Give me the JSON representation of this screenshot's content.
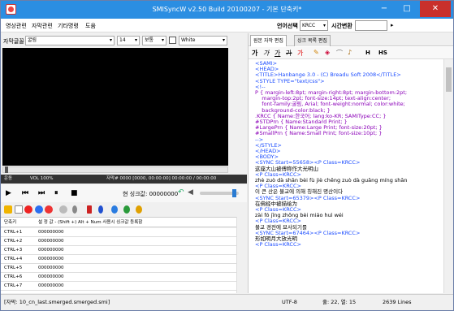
{
  "window": {
    "title": "SMISyncW v2.50 Build 20100207 - 기본 단축키*",
    "min": "−",
    "max": "□",
    "close": "✕"
  },
  "menu": {
    "items": [
      "영상관련",
      "자막관련",
      "기타명령",
      "도움"
    ],
    "lang_label": "언어선택",
    "lang_value": "KRCC",
    "time_label": "시간변환",
    "time_arrow": "▸"
  },
  "toolbar": {
    "font_label": "자막글꼴",
    "font_name": "굴림",
    "font_size": "14",
    "font_style": "보통",
    "color_name": "White"
  },
  "video_status": {
    "volume": "VOL 100%",
    "subtitle_info": "자막# 0000 [0000, 00:00:00] 00:00:00 / 00:00:00",
    "left_label": "운동"
  },
  "player": {
    "sync_label": "현 싱크값: 00000000",
    "buttons": [
      "▶",
      "⏮",
      "⏭",
      "⏸",
      "■"
    ]
  },
  "list": {
    "headers": [
      "단축키",
      "설 정 값 - (Shift +) Alt + Num 사용시 싱크값 등록함"
    ],
    "rows": [
      {
        "key": "CTRL+1",
        "value": "000000000"
      },
      {
        "key": "CTRL+2",
        "value": "000000000"
      },
      {
        "key": "CTRL+3",
        "value": "000000000"
      },
      {
        "key": "CTRL+4",
        "value": "000000000"
      },
      {
        "key": "CTRL+5",
        "value": "000000000"
      },
      {
        "key": "CTRL+6",
        "value": "000000000"
      },
      {
        "key": "CTRL+7",
        "value": "000000000"
      }
    ]
  },
  "right_pane": {
    "tabs": [
      "원본 자막 편집",
      "싱크 목록 편집"
    ],
    "edit_tools": [
      "가",
      "가",
      "가",
      "가",
      "가"
    ],
    "tool_extra": [
      "H",
      "HS"
    ],
    "editor_lines": [
      {
        "t": "<SAMI>",
        "c": "tag"
      },
      {
        "t": "<HEAD>",
        "c": "tag"
      },
      {
        "t": "<TITLE>Hanbange 3.0 - (C) Breadu Soft 2008</TITLE>",
        "c": "tag"
      },
      {
        "t": "<STYLE TYPE=\"text/css\">",
        "c": "tag"
      },
      {
        "t": "<!--",
        "c": "tag"
      },
      {
        "t": "P { margin-left:8pt; margin-right:8pt; margin-bottom:2pt;",
        "c": "purple"
      },
      {
        "t": "    margin-top:2pt; font-size:14pt; text-align:center;",
        "c": "purple"
      },
      {
        "t": "    font-family:굴림, Arial; font-weight:normal; color:white;",
        "c": "purple"
      },
      {
        "t": "    background-color:black; }",
        "c": "purple"
      },
      {
        "t": ".KRCC { Name:한국어; lang:ko-KR; SAMIType:CC; }",
        "c": "purple"
      },
      {
        "t": "#STDPrn { Name:Standard Print; }",
        "c": "purple"
      },
      {
        "t": "#LargePrn { Name:Large Print; font-size:20pt; }",
        "c": "purple"
      },
      {
        "t": "#SmallPrn { Name:Small Print; font-size:10pt; }",
        "c": "purple"
      },
      {
        "t": "-->",
        "c": "tag"
      },
      {
        "t": "</STYLE>",
        "c": "tag"
      },
      {
        "t": "</HEAD>",
        "c": "tag"
      },
      {
        "t": "<BODY>",
        "c": "tag"
      },
      {
        "t": "<SYNC Start=55658><P Class=KRCC>",
        "c": "tag"
      },
      {
        "t": "这座大山被傅称作大光明山",
        "c": "text"
      },
      {
        "t": "<P Class=KRCC>",
        "c": "tag"
      },
      {
        "t": "zhè zuò dà shān bèi fù jiè chēng zuò dà guāng míng shān",
        "c": "text"
      },
      {
        "t": "<P Class=KRCC>",
        "c": "tag"
      },
      {
        "t": "이 큰 산은 불교에 의해 칭해진 명산이다",
        "c": "text"
      },
      {
        "t": "<SYNC Start=65379><P Class=KRCC>",
        "c": "tag"
      },
      {
        "t": "在佛经中被描绘为",
        "c": "text"
      },
      {
        "t": "<P Class=KRCC>",
        "c": "tag"
      },
      {
        "t": "zài fó jīng zhōng bèi miáo huì wéi",
        "c": "text"
      },
      {
        "t": "<P Class=KRCC>",
        "c": "tag"
      },
      {
        "t": "불교 경전에 묘사되기를",
        "c": "text"
      },
      {
        "t": "<SYNC Start=67464><P Class=KRCC>",
        "c": "tag"
      },
      {
        "t": "形如明月大放光明",
        "c": "text"
      },
      {
        "t": "<P Class=KRCC>",
        "c": "tag"
      }
    ]
  },
  "statusbar": {
    "file": "[자막: 10_cn_last.smerged.smerged.smi]",
    "encoding": "UTF-8",
    "position": "줄: 22, 열: 15",
    "lines": "2639 Lines"
  },
  "colors": {
    "title_bar": "#2b8ee2",
    "close": "#c9302c",
    "tag": "#1b4cff",
    "purple": "#8b00b8"
  }
}
